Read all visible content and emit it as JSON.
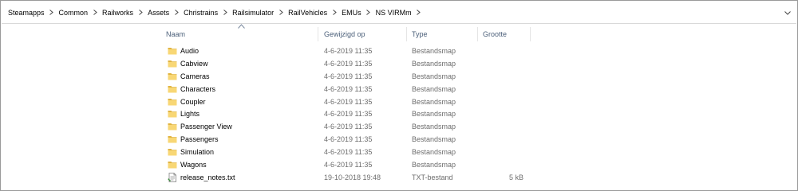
{
  "breadcrumb": [
    "Steamapps",
    "Common",
    "Railworks",
    "Assets",
    "Christrains",
    "Railsimulator",
    "RailVehicles",
    "EMUs",
    "NS VIRMm"
  ],
  "columns": {
    "name": "Naam",
    "date": "Gewijzigd op",
    "type": "Type",
    "size": "Grootte"
  },
  "files": [
    {
      "name": "Audio",
      "date": "4-6-2019 11:35",
      "type": "Bestandsmap",
      "size": "",
      "icon": "folder-icon"
    },
    {
      "name": "Cabview",
      "date": "4-6-2019 11:35",
      "type": "Bestandsmap",
      "size": "",
      "icon": "folder-icon"
    },
    {
      "name": "Cameras",
      "date": "4-6-2019 11:35",
      "type": "Bestandsmap",
      "size": "",
      "icon": "folder-icon"
    },
    {
      "name": "Characters",
      "date": "4-6-2019 11:35",
      "type": "Bestandsmap",
      "size": "",
      "icon": "folder-icon"
    },
    {
      "name": "Coupler",
      "date": "4-6-2019 11:35",
      "type": "Bestandsmap",
      "size": "",
      "icon": "folder-icon"
    },
    {
      "name": "Lights",
      "date": "4-6-2019 11:35",
      "type": "Bestandsmap",
      "size": "",
      "icon": "folder-icon"
    },
    {
      "name": "Passenger View",
      "date": "4-6-2019 11:35",
      "type": "Bestandsmap",
      "size": "",
      "icon": "folder-icon"
    },
    {
      "name": "Passengers",
      "date": "4-6-2019 11:35",
      "type": "Bestandsmap",
      "size": "",
      "icon": "folder-icon"
    },
    {
      "name": "Simulation",
      "date": "4-6-2019 11:35",
      "type": "Bestandsmap",
      "size": "",
      "icon": "folder-icon"
    },
    {
      "name": "Wagons",
      "date": "4-6-2019 11:35",
      "type": "Bestandsmap",
      "size": "",
      "icon": "folder-icon"
    },
    {
      "name": "release_notes.txt",
      "date": "19-10-2018 19:48",
      "type": "TXT-bestand",
      "size": "5 kB",
      "icon": "text-file-icon"
    }
  ],
  "colors": {
    "header_text": "#4c607a",
    "detail_text": "#6d6d6d",
    "folder_yellow": "#f8d775",
    "folder_dark": "#e0b33f"
  }
}
